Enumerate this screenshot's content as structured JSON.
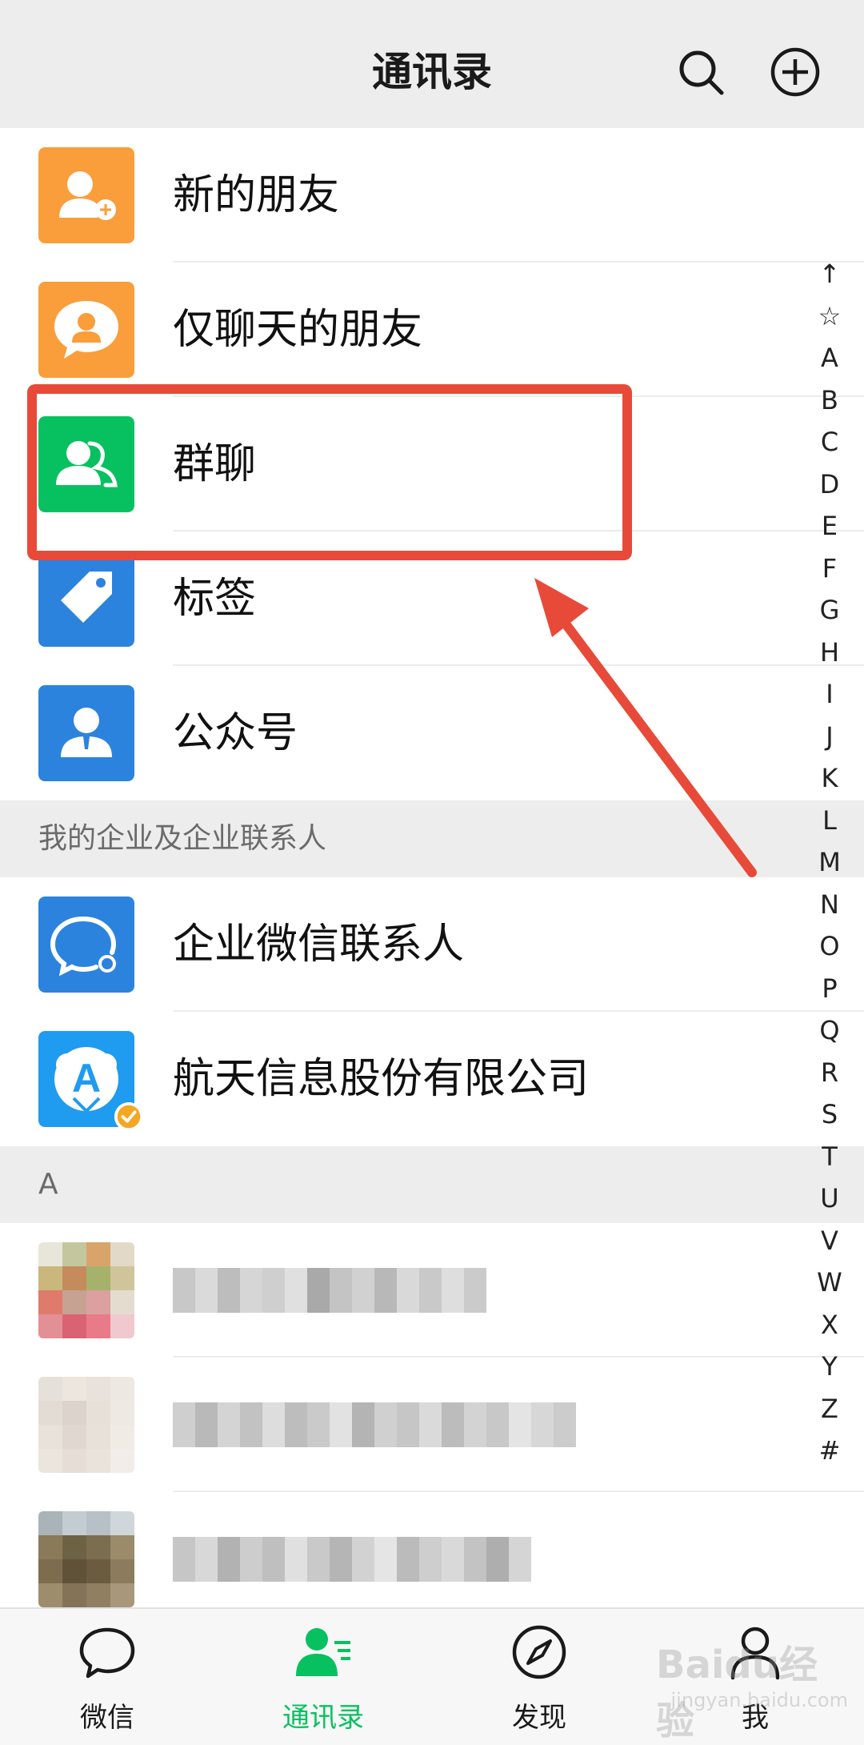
{
  "header": {
    "title": "通讯录"
  },
  "items": [
    {
      "label": "新的朋友",
      "icon": "add-friend-icon",
      "color": "#fa9d3b"
    },
    {
      "label": "仅聊天的朋友",
      "icon": "chat-only-friend-icon",
      "color": "#fa9d3b"
    },
    {
      "label": "群聊",
      "icon": "group-chat-icon",
      "color": "#07c160"
    },
    {
      "label": "标签",
      "icon": "tag-icon",
      "color": "#2b83de"
    },
    {
      "label": "公众号",
      "icon": "official-account-icon",
      "color": "#2b83de"
    }
  ],
  "enterprise": {
    "section_title": "我的企业及企业联系人",
    "items": [
      {
        "label": "企业微信联系人",
        "icon": "wecom-contacts-icon",
        "color": "#2b83de"
      },
      {
        "label": "航天信息股份有限公司",
        "icon": "company-logo-icon",
        "color": "#1f9bf0"
      }
    ]
  },
  "contacts": {
    "section_letter": "A"
  },
  "index_letters": [
    "↑",
    "☆",
    "A",
    "B",
    "C",
    "D",
    "E",
    "F",
    "G",
    "H",
    "I",
    "J",
    "K",
    "L",
    "M",
    "N",
    "O",
    "P",
    "Q",
    "R",
    "S",
    "T",
    "U",
    "V",
    "W",
    "X",
    "Y",
    "Z",
    "#"
  ],
  "tabs": [
    {
      "label": "微信",
      "icon": "chat-bubble-icon"
    },
    {
      "label": "通讯录",
      "icon": "contacts-icon",
      "active": true
    },
    {
      "label": "发现",
      "icon": "compass-icon"
    },
    {
      "label": "我",
      "icon": "person-icon"
    }
  ],
  "watermark": {
    "main": "Baidu经验",
    "sub": "jingyan.baidu.com"
  },
  "colors": {
    "accent_green": "#07c160",
    "annotation_red": "#e84a3a"
  }
}
